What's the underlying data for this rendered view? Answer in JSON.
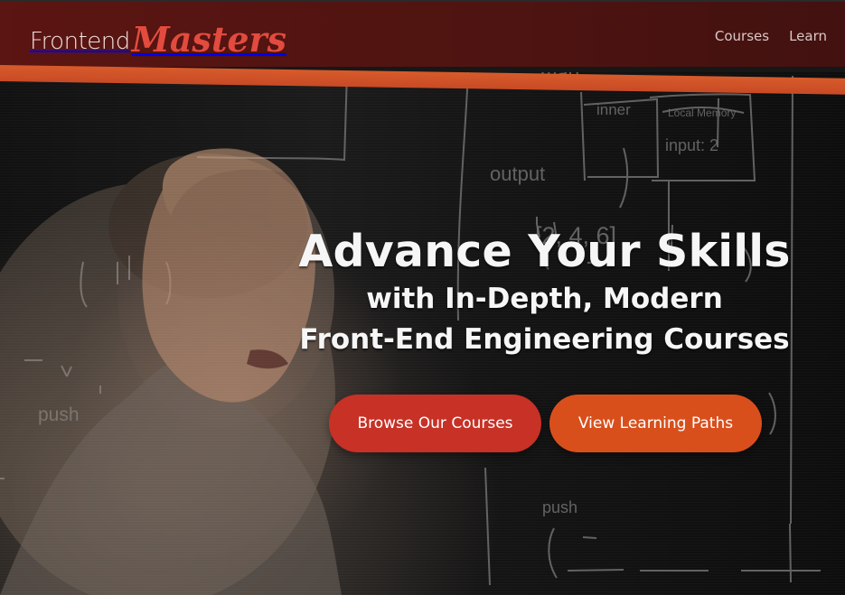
{
  "app": {
    "logo_frontend": "Frontend",
    "logo_masters": "Masters"
  },
  "nav": {
    "items": [
      {
        "label": "Courses"
      },
      {
        "label": "Learn"
      }
    ]
  },
  "hero": {
    "title": "Advance Your Skills",
    "subtitle_line1": "with In-Depth, Modern",
    "subtitle_line2": "Front-End Engineering Courses",
    "primary_button": "Browse Our Courses",
    "secondary_button": "View Learning Paths",
    "whiteboard": {
      "snippet_output": "output",
      "snippet_inner": "inner",
      "snippet_input": "input: 2",
      "snippet_result": "Local Memory",
      "snippet_push": "push",
      "snippet_map": "map",
      "snippet_values": "[2, 4, 6]"
    }
  },
  "colors": {
    "header": "#5b1512",
    "stripe": "#d75b2b",
    "button_red": "#c73126",
    "button_orange": "#d94f1c"
  }
}
